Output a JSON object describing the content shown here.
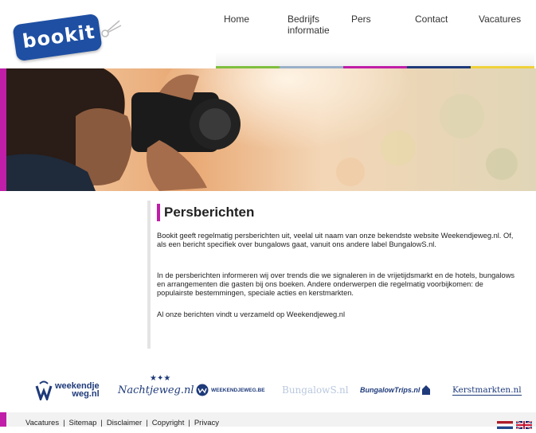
{
  "logo": {
    "text": "bookit"
  },
  "nav": [
    {
      "label": "Home",
      "accent": "#7fbf3f"
    },
    {
      "label": "Bedrijfs informatie",
      "accent": "#9ab0c8"
    },
    {
      "label": "Pers",
      "accent": "#c01ea8"
    },
    {
      "label": "Contact",
      "accent": "#1e3a7a"
    },
    {
      "label": "Vacatures",
      "accent": "#f0d23a"
    }
  ],
  "content": {
    "title": "Persberichten",
    "paragraphs": [
      "Bookit geeft regelmatig persberichten uit, veelal uit naam van onze bekendste website Weekendjeweg.nl. Of, als een bericht specifiek over bungalows gaat, vanuit ons andere label BungalowS.nl.",
      "In de persberichten informeren wij over trends die we signaleren in de vrijetijdsmarkt en de hotels, bungalows en arrangementen die gasten bij ons boeken. Andere onderwerpen die regelmatig voorbijkomen: de populairste bestemmingen, speciale acties en kerstmarkten.",
      "Al onze berichten vindt u verzameld op Weekendjeweg.nl"
    ]
  },
  "partners": {
    "weekendjeweg_line1": "weekendje",
    "weekendjeweg_line2": "weg.nl",
    "nachtjeweg": "Nachtjeweg.nl",
    "weekendjeweg_be": "WEEKENDJEWEG.BE",
    "bungalows": "BungalowS.nl",
    "bungalowtrips": "BungalowTrips.nl",
    "kerstmarkten": "Kerstmarkten.nl"
  },
  "footer": {
    "links": [
      "Vacatures",
      "Sitemap",
      "Disclaimer",
      "Copyright",
      "Privacy"
    ]
  },
  "colors": {
    "accent": "#c01ea8",
    "brand": "#1e4fa3"
  }
}
